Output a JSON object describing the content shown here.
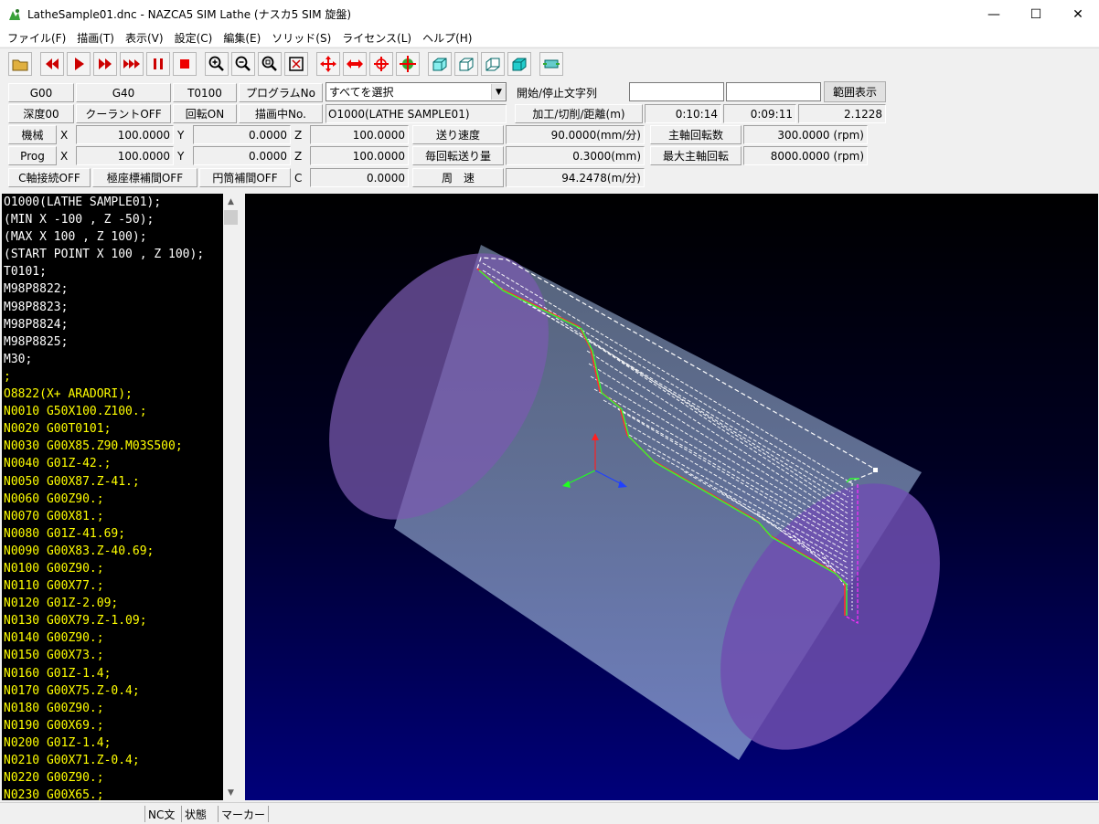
{
  "window": {
    "title": "LatheSample01.dnc - NAZCA5 SIM Lathe (ナスカ5 SIM 旋盤)",
    "minimize": "—",
    "maximize": "☐",
    "close": "✕"
  },
  "menu": [
    "ファイル(F)",
    "描画(T)",
    "表示(V)",
    "設定(C)",
    "編集(E)",
    "ソリッド(S)",
    "ライセンス(L)",
    "ヘルプ(H)"
  ],
  "toolbar": {
    "icons": [
      "open-folder-icon",
      "rewind-icon",
      "play-icon",
      "fast-forward-icon",
      "skip-to-end-icon",
      "pause-icon",
      "stop-icon",
      "zoom-in-icon",
      "zoom-out-icon",
      "zoom-window-icon",
      "zoom-fit-icon",
      "pan-icon",
      "horizontal-move-icon",
      "rotate-icon",
      "view-rotate-icon",
      "view-iso-1-icon",
      "view-iso-2-icon",
      "view-iso-3-icon",
      "view-iso-4-icon",
      "tool-display-icon"
    ]
  },
  "status": {
    "g00": "G00",
    "g40": "G40",
    "tool": "T0100",
    "program_no_label": "プログラムNo",
    "program_select": "すべてを選択",
    "start_stop_label": "開始/停止文字列",
    "start_value": "",
    "stop_value": "",
    "range_button": "範囲表示",
    "depth": "深度00",
    "coolant": "クーラントOFF",
    "rotation": "回転ON",
    "drawing_no_label": "描画中No.",
    "drawing_no": "O1000(LATHE SAMPLE01)",
    "distance_label": "加工/切削/距離(m)",
    "time1": "0:10:14",
    "time2": "0:09:11",
    "distance": "2.1228",
    "machine_label": "機械",
    "prog_label": "Prog",
    "x_label": "X",
    "y_label": "Y",
    "z_label": "Z",
    "c_label": "C",
    "machine_x": "100.0000",
    "machine_y": "0.0000",
    "machine_z": "100.0000",
    "prog_x": "100.0000",
    "prog_y": "0.0000",
    "prog_z": "100.0000",
    "feed_label": "送り速度",
    "feed_value": "90.0000(mm/分)",
    "feed_per_rev_label": "毎回転送り量",
    "feed_per_rev_value": "0.3000(mm)",
    "surface_speed_label": "周　速",
    "surface_speed_value": "94.2478(m/分)",
    "spindle_label": "主軸回転数",
    "spindle_value": "300.0000 (rpm)",
    "max_spindle_label": "最大主軸回転",
    "max_spindle_value": "8000.0000 (rpm)",
    "c_axis": "C軸接続OFF",
    "polar": "極座標補間OFF",
    "cylinder": "円筒補間OFF",
    "c_value": "0.0000"
  },
  "code_lines": [
    {
      "t": "O1000(LATHE SAMPLE01);",
      "c": "#ffffff"
    },
    {
      "t": "(MIN X -100 , Z -50);",
      "c": "#ffffff"
    },
    {
      "t": "(MAX X 100 , Z 100);",
      "c": "#ffffff"
    },
    {
      "t": "(START POINT X 100 , Z 100);",
      "c": "#ffffff"
    },
    {
      "t": "T0101;",
      "c": "#ffffff"
    },
    {
      "t": "M98P8822;",
      "c": "#ffffff"
    },
    {
      "t": "M98P8823;",
      "c": "#ffffff"
    },
    {
      "t": "M98P8824;",
      "c": "#ffffff"
    },
    {
      "t": "M98P8825;",
      "c": "#ffffff"
    },
    {
      "t": "M30;",
      "c": "#ffffff"
    },
    {
      "t": ";",
      "c": "#ffff00"
    },
    {
      "t": "O8822(X+ ARADORI);",
      "c": "#ffff00"
    },
    {
      "t": "N0010 G50X100.Z100.;",
      "c": "#ffff00"
    },
    {
      "t": "N0020 G00T0101;",
      "c": "#ffff00"
    },
    {
      "t": "N0030 G00X85.Z90.M03S500;",
      "c": "#ffff00"
    },
    {
      "t": "N0040 G01Z-42.;",
      "c": "#ffff00"
    },
    {
      "t": "N0050 G00X87.Z-41.;",
      "c": "#ffff00"
    },
    {
      "t": "N0060 G00Z90.;",
      "c": "#ffff00"
    },
    {
      "t": "N0070 G00X81.;",
      "c": "#ffff00"
    },
    {
      "t": "N0080 G01Z-41.69;",
      "c": "#ffff00"
    },
    {
      "t": "N0090 G00X83.Z-40.69;",
      "c": "#ffff00"
    },
    {
      "t": "N0100 G00Z90.;",
      "c": "#ffff00"
    },
    {
      "t": "N0110 G00X77.;",
      "c": "#ffff00"
    },
    {
      "t": "N0120 G01Z-2.09;",
      "c": "#ffff00"
    },
    {
      "t": "N0130 G00X79.Z-1.09;",
      "c": "#ffff00"
    },
    {
      "t": "N0140 G00Z90.;",
      "c": "#ffff00"
    },
    {
      "t": "N0150 G00X73.;",
      "c": "#ffff00"
    },
    {
      "t": "N0160 G01Z-1.4;",
      "c": "#ffff00"
    },
    {
      "t": "N0170 G00X75.Z-0.4;",
      "c": "#ffff00"
    },
    {
      "t": "N0180 G00Z90.;",
      "c": "#ffff00"
    },
    {
      "t": "N0190 G00X69.;",
      "c": "#ffff00"
    },
    {
      "t": "N0200 G01Z-1.4;",
      "c": "#ffff00"
    },
    {
      "t": "N0210 G00X71.Z-0.4;",
      "c": "#ffff00"
    },
    {
      "t": "N0220 G00Z90.;",
      "c": "#ffff00"
    },
    {
      "t": "N0230 G00X65.;",
      "c": "#ffff00"
    }
  ],
  "statusbar": {
    "nc": "NC文",
    "state": "状態",
    "marker": "マーカー"
  },
  "colors": {
    "cylinder_end": "#7a5fb8",
    "cylinder_body": "#8da6cf",
    "toolpath": "#ffffff",
    "finish_red": "#ff3030",
    "finish_green": "#30ff30",
    "finish_magenta": "#ff30ff"
  }
}
